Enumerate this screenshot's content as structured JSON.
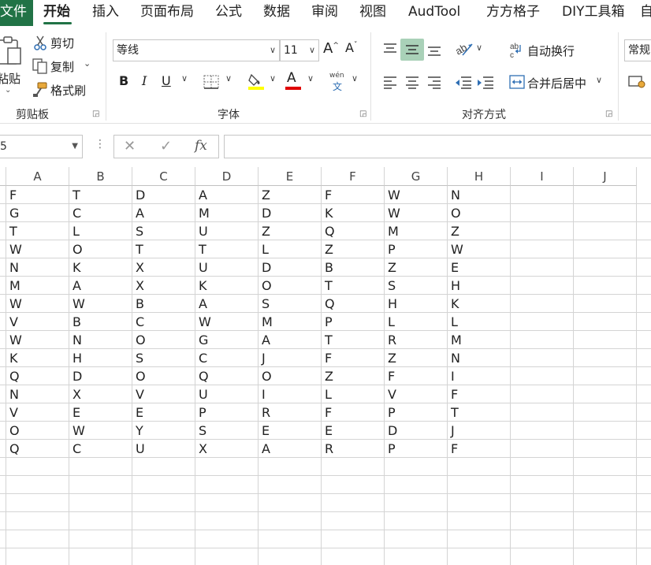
{
  "menu": {
    "file": "文件",
    "tabs": [
      "开始",
      "插入",
      "页面布局",
      "公式",
      "数据",
      "审阅",
      "视图",
      "AudTool",
      "方方格子",
      "DIY工具箱",
      "自"
    ]
  },
  "ribbon": {
    "clipboard": {
      "paste": "粘贴",
      "cut": "剪切",
      "copy": "复制",
      "format_painter": "格式刷",
      "label": "剪贴板"
    },
    "font": {
      "font_name": "等线",
      "font_size": "11",
      "grow": "A",
      "shrink": "A",
      "bold": "B",
      "italic": "I",
      "underline": "U",
      "font_color_letter": "A",
      "phonetic_top": "wén",
      "phonetic_bottom": "文",
      "label": "字体"
    },
    "alignment": {
      "wrap_text": "自动换行",
      "merge_center": "合并后居中",
      "label": "对齐方式"
    },
    "number": {
      "format": "常规"
    }
  },
  "formula_bar": {
    "name_box": "5",
    "cancel": "✕",
    "enter": "✓",
    "fx": "fx",
    "value": ""
  },
  "sheet": {
    "columns": [
      "A",
      "B",
      "C",
      "D",
      "E",
      "F",
      "G",
      "H",
      "I",
      "J"
    ],
    "rows": [
      [
        "F",
        "T",
        "D",
        "A",
        "Z",
        "F",
        "W",
        "N"
      ],
      [
        "G",
        "C",
        "A",
        "M",
        "D",
        "K",
        "W",
        "O"
      ],
      [
        "T",
        "L",
        "S",
        "U",
        "Z",
        "Q",
        "M",
        "Z"
      ],
      [
        "W",
        "O",
        "T",
        "T",
        "L",
        "Z",
        "P",
        "W"
      ],
      [
        "N",
        "K",
        "X",
        "U",
        "D",
        "B",
        "Z",
        "E"
      ],
      [
        "M",
        "A",
        "X",
        "K",
        "O",
        "T",
        "S",
        "H"
      ],
      [
        "W",
        "W",
        "B",
        "A",
        "S",
        "Q",
        "H",
        "K"
      ],
      [
        "V",
        "B",
        "C",
        "W",
        "M",
        "P",
        "L",
        "L"
      ],
      [
        "W",
        "N",
        "O",
        "G",
        "A",
        "T",
        "R",
        "M"
      ],
      [
        "K",
        "H",
        "S",
        "C",
        "J",
        "F",
        "Z",
        "N"
      ],
      [
        "Q",
        "D",
        "O",
        "Q",
        "O",
        "Z",
        "F",
        "I"
      ],
      [
        "N",
        "X",
        "V",
        "U",
        "I",
        "L",
        "V",
        "F"
      ],
      [
        "V",
        "E",
        "E",
        "P",
        "R",
        "F",
        "P",
        "T"
      ],
      [
        "O",
        "W",
        "Y",
        "S",
        "E",
        "E",
        "D",
        "J"
      ],
      [
        "Q",
        "C",
        "U",
        "X",
        "A",
        "R",
        "P",
        "F"
      ]
    ]
  },
  "colors": {
    "accent": "#217346",
    "selected_button": "#a9d1b8",
    "font_color_bar": "#e00000",
    "highlight_bar": "#ffff00"
  }
}
